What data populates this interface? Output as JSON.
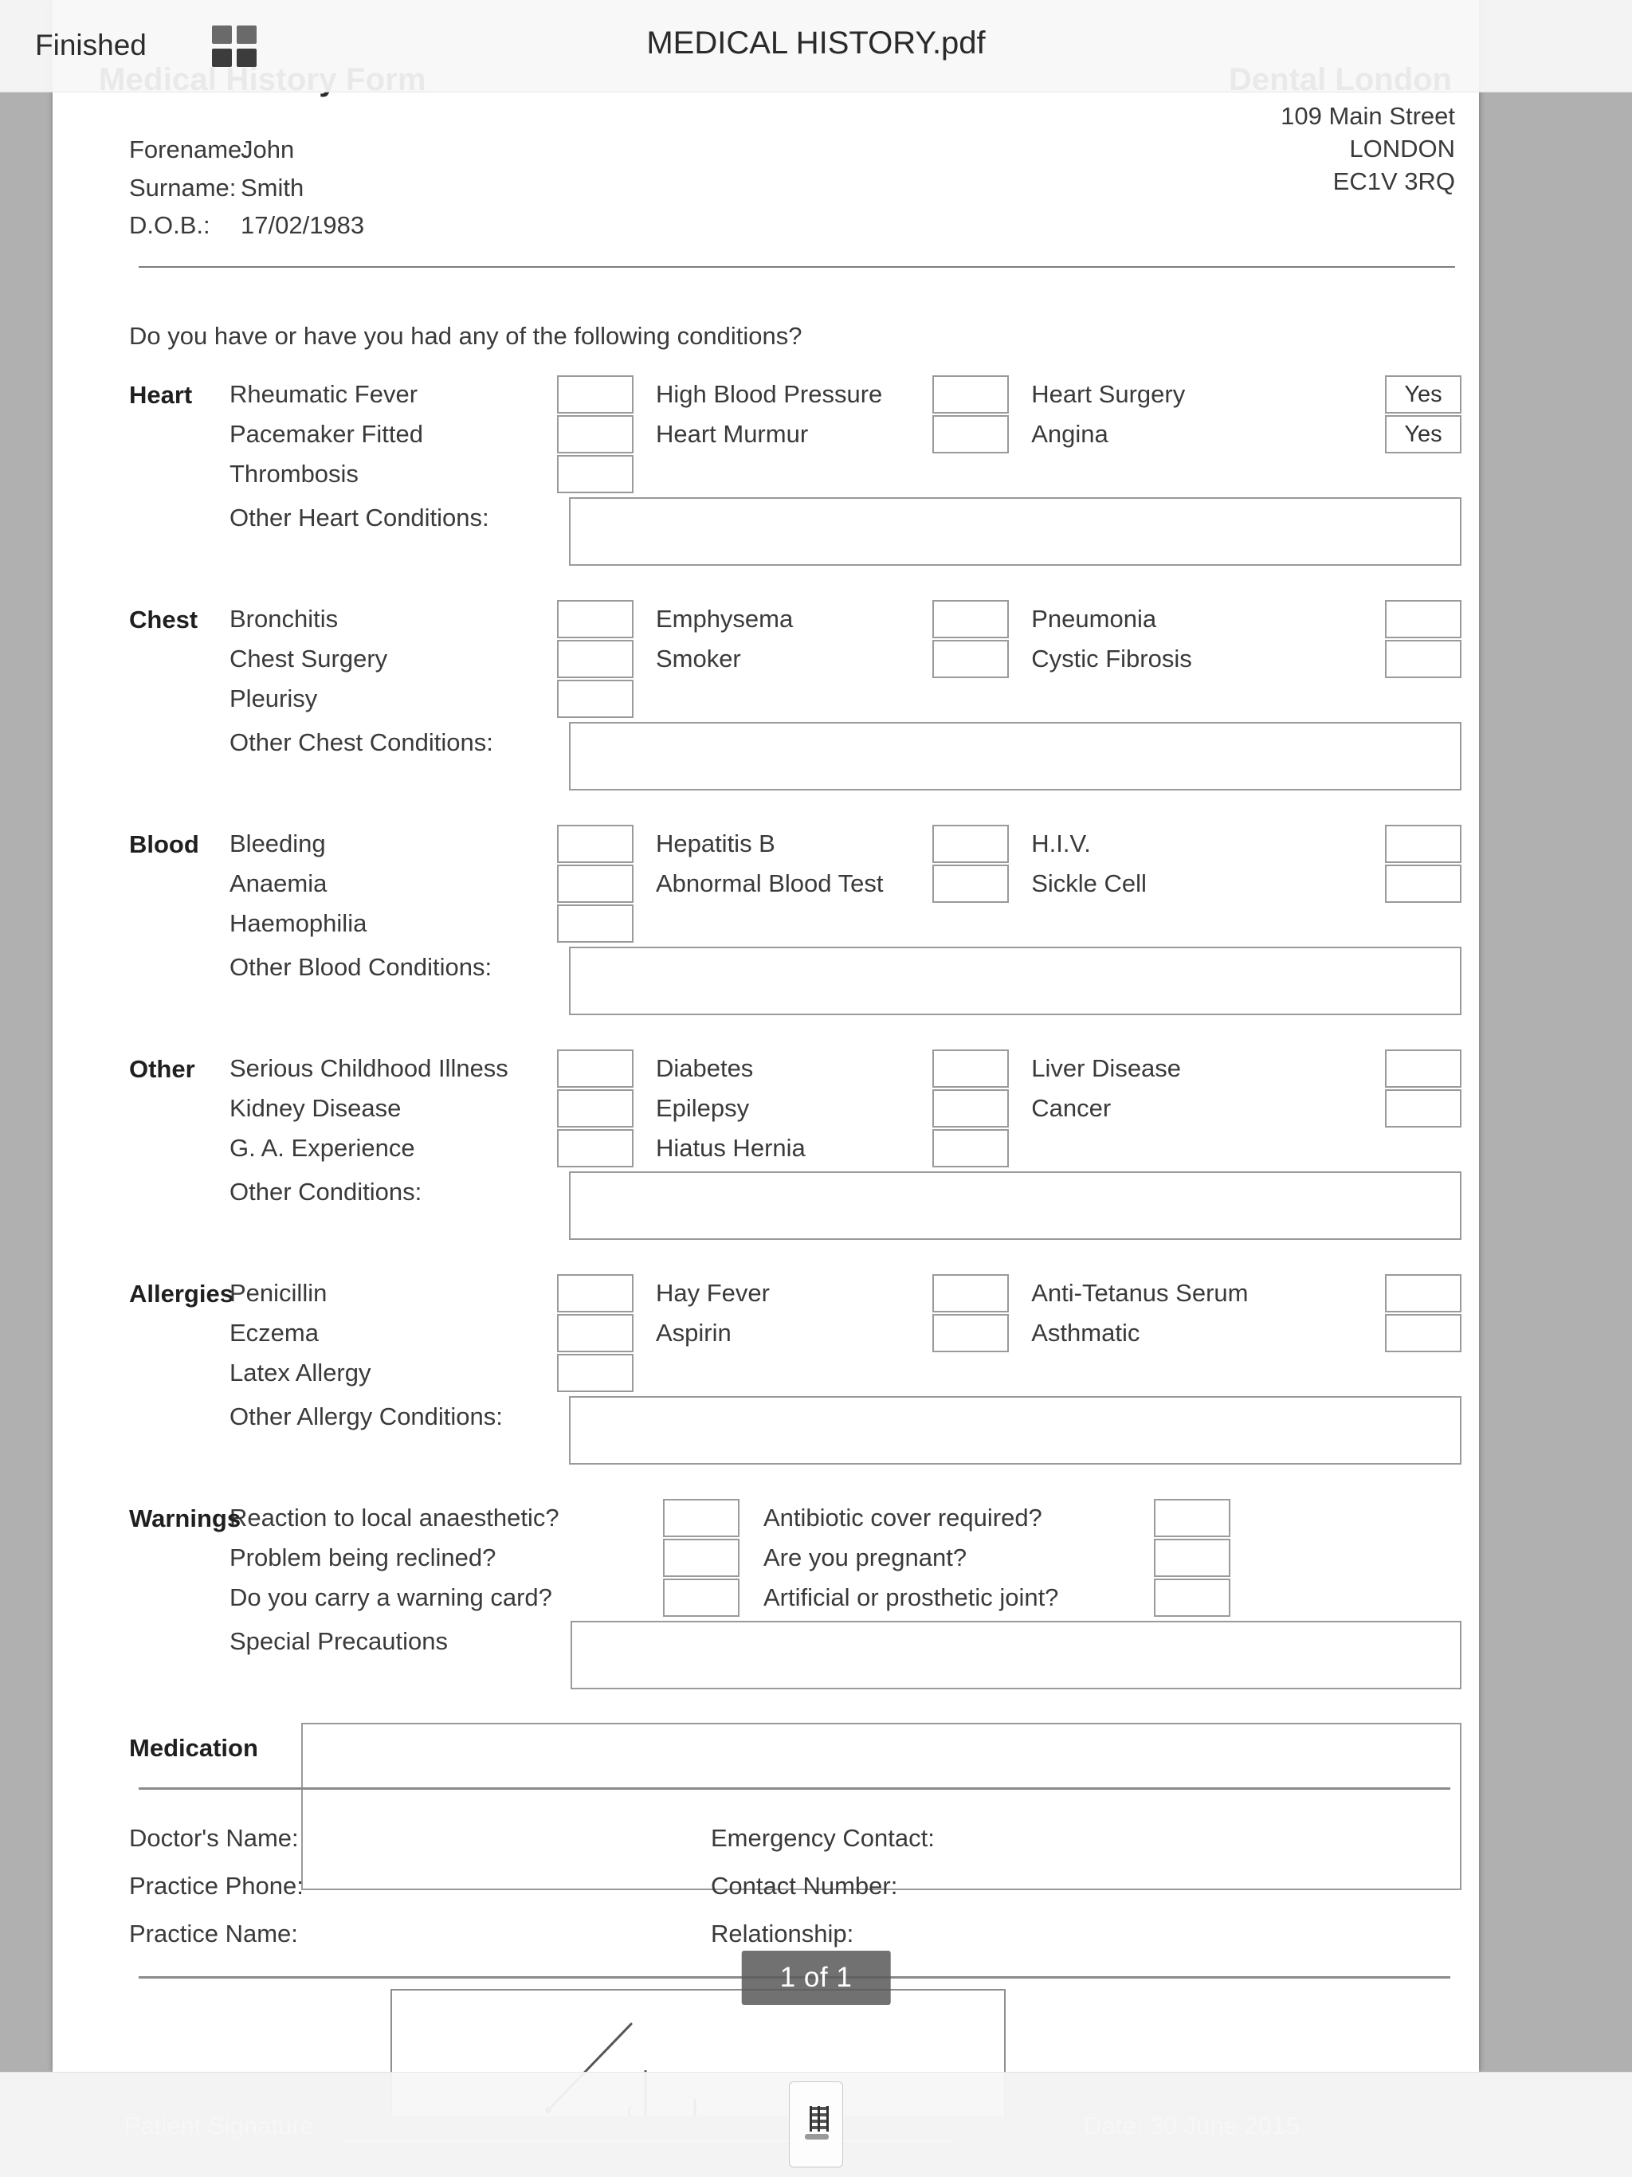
{
  "toolbar": {
    "finished_label": "Finished",
    "grid_icon": "grid-2x2-icon",
    "document_name": "MEDICAL HISTORY.pdf"
  },
  "page_badge": {
    "text": "1 of 1"
  },
  "bottom_toolbar": {
    "thumbnail_icon": "document-pages-icon"
  },
  "document": {
    "title": "Medical History Form",
    "clinic_name": "Dental London",
    "address": {
      "line1": "109 Main Street",
      "line2": "LONDON",
      "line3": "EC1V 3RQ"
    },
    "patient": {
      "forename_label": "Forename:",
      "forename_value": "John",
      "surname_label": "Surname:",
      "surname_value": "Smith",
      "dob_label": "D.O.B.:",
      "dob_value": "17/02/1983"
    },
    "question": "Do you have or have you had any of the following conditions?",
    "sections": [
      {
        "title": "Heart",
        "rows": [
          {
            "c1": "Rheumatic Fever",
            "v1": "",
            "c2": "High Blood Pressure",
            "v2": "",
            "c3": "Heart Surgery",
            "v3": "Yes"
          },
          {
            "c1": "Pacemaker Fitted",
            "v1": "",
            "c2": "Heart Murmur",
            "v2": "",
            "c3": "Angina",
            "v3": "Yes"
          },
          {
            "c1": "Thrombosis",
            "v1": "",
            "c2": "",
            "v2": null,
            "c3": "",
            "v3": null
          }
        ],
        "other_label": "Other Heart Conditions:",
        "other_value": ""
      },
      {
        "title": "Chest",
        "rows": [
          {
            "c1": "Bronchitis",
            "v1": "",
            "c2": "Emphysema",
            "v2": "",
            "c3": "Pneumonia",
            "v3": ""
          },
          {
            "c1": "Chest Surgery",
            "v1": "",
            "c2": "Smoker",
            "v2": "",
            "c3": "Cystic Fibrosis",
            "v3": ""
          },
          {
            "c1": "Pleurisy",
            "v1": "",
            "c2": "",
            "v2": null,
            "c3": "",
            "v3": null
          }
        ],
        "other_label": "Other Chest Conditions:",
        "other_value": ""
      },
      {
        "title": "Blood",
        "rows": [
          {
            "c1": "Bleeding",
            "v1": "",
            "c2": "Hepatitis B",
            "v2": "",
            "c3": "H.I.V.",
            "v3": ""
          },
          {
            "c1": "Anaemia",
            "v1": "",
            "c2": "Abnormal Blood Test",
            "v2": "",
            "c3": "Sickle Cell",
            "v3": ""
          },
          {
            "c1": "Haemophilia",
            "v1": "",
            "c2": "",
            "v2": null,
            "c3": "",
            "v3": null
          }
        ],
        "other_label": "Other Blood Conditions:",
        "other_value": ""
      },
      {
        "title": "Other",
        "rows": [
          {
            "c1": "Serious Childhood Illness",
            "v1": "",
            "c2": "Diabetes",
            "v2": "",
            "c3": "Liver Disease",
            "v3": ""
          },
          {
            "c1": "Kidney Disease",
            "v1": "",
            "c2": "Epilepsy",
            "v2": "",
            "c3": "Cancer",
            "v3": ""
          },
          {
            "c1": "G. A. Experience",
            "v1": "",
            "c2": "Hiatus Hernia",
            "v2": "",
            "c3": "",
            "v3": null
          }
        ],
        "other_label": "Other Conditions:",
        "other_value": ""
      },
      {
        "title": "Allergies",
        "rows": [
          {
            "c1": "Penicillin",
            "v1": "",
            "c2": "Hay Fever",
            "v2": "",
            "c3": "Anti-Tetanus Serum",
            "v3": ""
          },
          {
            "c1": "Eczema",
            "v1": "",
            "c2": "Aspirin",
            "v2": "",
            "c3": "Asthmatic",
            "v3": ""
          },
          {
            "c1": "Latex Allergy",
            "v1": "",
            "c2": "",
            "v2": null,
            "c3": "",
            "v3": null
          }
        ],
        "other_label": "Other Allergy Conditions:",
        "other_value": ""
      }
    ],
    "warnings": {
      "title": "Warnings",
      "rows": [
        {
          "left": "Reaction to local anaesthetic?",
          "left_value": "",
          "right": "Antibiotic cover required?",
          "right_value": ""
        },
        {
          "left": "Problem being reclined?",
          "left_value": "",
          "right": "Are you pregnant?",
          "right_value": ""
        },
        {
          "left": "Do you carry a warning card?",
          "left_value": "",
          "right": "Artificial or prosthetic joint?",
          "right_value": ""
        }
      ],
      "other_label": "Special Precautions",
      "other_value": ""
    },
    "medication": {
      "label": "Medication",
      "value": ""
    },
    "footer": {
      "left": [
        "Doctor's Name:",
        "Practice Phone:",
        "Practice Name:"
      ],
      "right": [
        "Emergency Contact:",
        "Contact Number:",
        "Relationship:"
      ]
    },
    "signature": {
      "patient_signature_label": "Patient Signature",
      "date_label": "Date: 30 June 2015"
    }
  }
}
